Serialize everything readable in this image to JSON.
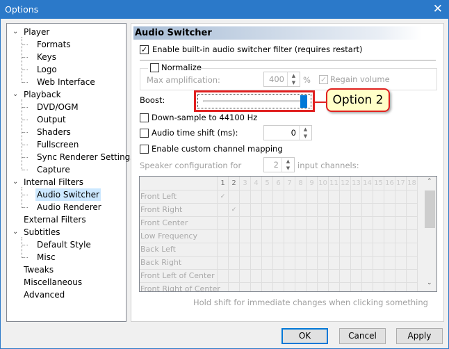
{
  "window": {
    "title": "Options",
    "close_icon": "close-icon"
  },
  "tree": {
    "items": [
      {
        "label": "Player",
        "level": 0,
        "expanded": true
      },
      {
        "label": "Formats",
        "level": 1
      },
      {
        "label": "Keys",
        "level": 1
      },
      {
        "label": "Logo",
        "level": 1
      },
      {
        "label": "Web Interface",
        "level": 1
      },
      {
        "label": "Playback",
        "level": 0,
        "expanded": true
      },
      {
        "label": "DVD/OGM",
        "level": 1
      },
      {
        "label": "Output",
        "level": 1
      },
      {
        "label": "Shaders",
        "level": 1
      },
      {
        "label": "Fullscreen",
        "level": 1
      },
      {
        "label": "Sync Renderer Settings",
        "level": 1
      },
      {
        "label": "Capture",
        "level": 1
      },
      {
        "label": "Internal Filters",
        "level": 0,
        "expanded": true
      },
      {
        "label": "Audio Switcher",
        "level": 1,
        "selected": true
      },
      {
        "label": "Audio Renderer",
        "level": 1
      },
      {
        "label": "External Filters",
        "level": 0
      },
      {
        "label": "Subtitles",
        "level": 0,
        "expanded": true
      },
      {
        "label": "Default Style",
        "level": 1
      },
      {
        "label": "Misc",
        "level": 1
      },
      {
        "label": "Tweaks",
        "level": 0
      },
      {
        "label": "Miscellaneous",
        "level": 0
      },
      {
        "label": "Advanced",
        "level": 0
      }
    ]
  },
  "panel": {
    "title": "Audio Switcher",
    "enable_switcher": {
      "label": "Enable built-in audio switcher filter (requires restart)",
      "checked": true
    },
    "normalize": {
      "label": "Normalize",
      "checked": false
    },
    "max_amp": {
      "label": "Max amplification:",
      "value": "400",
      "unit": "%"
    },
    "regain": {
      "label": "Regain volume",
      "checked": true
    },
    "boost": {
      "label": "Boost:",
      "value_percent": 100
    },
    "callout": "Option 2",
    "downsample": {
      "label": "Down-sample to 44100 Hz",
      "checked": false
    },
    "time_shift": {
      "label": "Audio time shift (ms):",
      "checked": false,
      "value": "0"
    },
    "custom_mapping": {
      "label": "Enable custom channel mapping",
      "checked": false
    },
    "speaker_cfg": {
      "label": "Speaker configuration for",
      "value": "2",
      "suffix": "input channels:"
    },
    "grid": {
      "columns": [
        "1",
        "2",
        "3",
        "4",
        "5",
        "6",
        "7",
        "8",
        "9",
        "10",
        "11",
        "12",
        "13",
        "14",
        "15",
        "16",
        "17",
        "18"
      ],
      "rows": [
        "Front Left",
        "Front Right",
        "Front Center",
        "Low Frequency",
        "Back Left",
        "Back Right",
        "Front Left of Center",
        "Front Right of Center"
      ],
      "checks": [
        [
          0,
          0
        ],
        [
          1,
          1
        ]
      ]
    },
    "hint": "Hold shift for immediate changes when clicking something"
  },
  "buttons": {
    "ok": "OK",
    "cancel": "Cancel",
    "apply": "Apply"
  },
  "colors": {
    "accent": "#2b79c9",
    "callout_border": "#e02020",
    "callout_bg": "#ffffc8",
    "thumb": "#0078d7"
  }
}
